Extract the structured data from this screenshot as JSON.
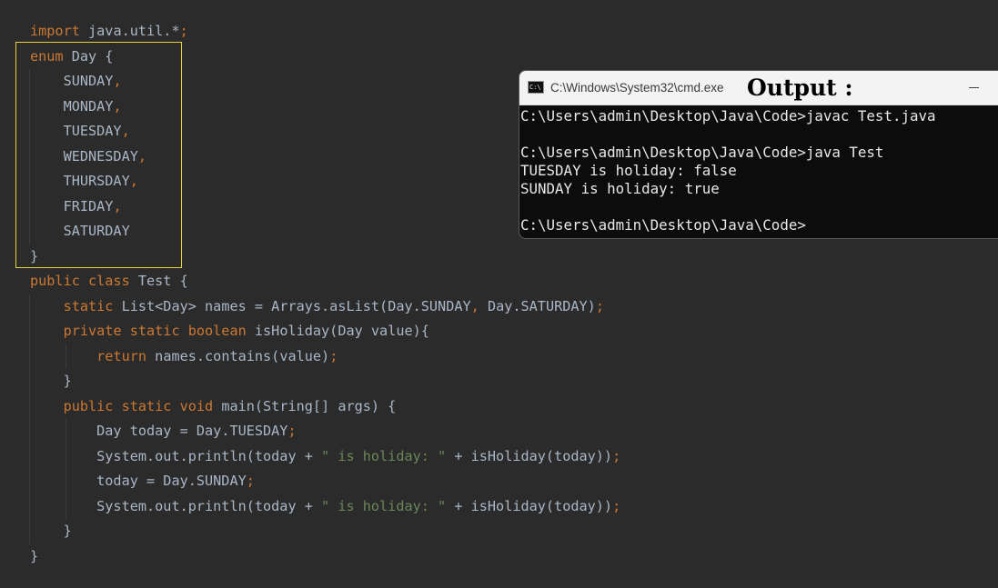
{
  "editor": {
    "lines": [
      [
        {
          "t": "import ",
          "c": "kw"
        },
        {
          "t": "java.util.*",
          "c": "plain"
        },
        {
          "t": ";",
          "c": "punct"
        }
      ],
      [
        {
          "t": "enum ",
          "c": "kw"
        },
        {
          "t": "Day {",
          "c": "plain"
        }
      ],
      [
        {
          "t": "    SUNDAY",
          "c": "plain"
        },
        {
          "t": ",",
          "c": "punct"
        }
      ],
      [
        {
          "t": "    MONDAY",
          "c": "plain"
        },
        {
          "t": ",",
          "c": "punct"
        }
      ],
      [
        {
          "t": "    TUESDAY",
          "c": "plain"
        },
        {
          "t": ",",
          "c": "punct"
        }
      ],
      [
        {
          "t": "    WEDNESDAY",
          "c": "plain"
        },
        {
          "t": ",",
          "c": "punct"
        }
      ],
      [
        {
          "t": "    THURSDAY",
          "c": "plain"
        },
        {
          "t": ",",
          "c": "punct"
        }
      ],
      [
        {
          "t": "    FRIDAY",
          "c": "plain"
        },
        {
          "t": ",",
          "c": "punct"
        }
      ],
      [
        {
          "t": "    SATURDAY",
          "c": "plain"
        }
      ],
      [
        {
          "t": "}",
          "c": "plain"
        }
      ],
      [
        {
          "t": "public class ",
          "c": "kw"
        },
        {
          "t": "Test {",
          "c": "plain"
        }
      ],
      [
        {
          "t": "    ",
          "c": "plain"
        },
        {
          "t": "static ",
          "c": "kw"
        },
        {
          "t": "List<Day> names = Arrays.asList(Day.SUNDAY",
          "c": "plain"
        },
        {
          "t": ", ",
          "c": "punct"
        },
        {
          "t": "Day.SATURDAY)",
          "c": "plain"
        },
        {
          "t": ";",
          "c": "punct"
        }
      ],
      [
        {
          "t": "    ",
          "c": "plain"
        },
        {
          "t": "private static boolean ",
          "c": "kw"
        },
        {
          "t": "isHoliday(Day value){",
          "c": "plain"
        }
      ],
      [
        {
          "t": "        ",
          "c": "plain"
        },
        {
          "t": "return ",
          "c": "kw"
        },
        {
          "t": "names.contains(value)",
          "c": "plain"
        },
        {
          "t": ";",
          "c": "punct"
        }
      ],
      [
        {
          "t": "    }",
          "c": "plain"
        }
      ],
      [
        {
          "t": "    ",
          "c": "plain"
        },
        {
          "t": "public static void ",
          "c": "kw"
        },
        {
          "t": "main(String[] args) {",
          "c": "plain"
        }
      ],
      [
        {
          "t": "        Day today = Day.TUESDAY",
          "c": "plain"
        },
        {
          "t": ";",
          "c": "punct"
        }
      ],
      [
        {
          "t": "        System.out.println(today + ",
          "c": "plain"
        },
        {
          "t": "\" is holiday: \"",
          "c": "str"
        },
        {
          "t": " + isHoliday(today))",
          "c": "plain"
        },
        {
          "t": ";",
          "c": "punct"
        }
      ],
      [
        {
          "t": "        today = Day.SUNDAY",
          "c": "plain"
        },
        {
          "t": ";",
          "c": "punct"
        }
      ],
      [
        {
          "t": "        System.out.println(today + ",
          "c": "plain"
        },
        {
          "t": "\" is holiday: \"",
          "c": "str"
        },
        {
          "t": " + isHoliday(today))",
          "c": "plain"
        },
        {
          "t": ";",
          "c": "punct"
        }
      ],
      [
        {
          "t": "    }",
          "c": "plain"
        }
      ],
      [
        {
          "t": "}",
          "c": "plain"
        }
      ]
    ]
  },
  "colors": {
    "background": "#2b2b2b",
    "keyword": "#cc7832",
    "string": "#6a8759",
    "plain": "#a9b7c6",
    "highlight_box": "#e3d23e",
    "console_bg": "#0c0c0c",
    "console_text": "#e8e8e8"
  },
  "console": {
    "icon": "cmd-icon",
    "icon_text": "C:\\",
    "title": "C:\\Windows\\System32\\cmd.exe",
    "output_label": "Output :",
    "minimize_icon": "minimize-icon",
    "lines": [
      "C:\\Users\\admin\\Desktop\\Java\\Code>javac Test.java",
      "",
      "C:\\Users\\admin\\Desktop\\Java\\Code>java Test",
      "TUESDAY is holiday: false",
      "SUNDAY is holiday: true",
      "",
      "C:\\Users\\admin\\Desktop\\Java\\Code>"
    ]
  }
}
